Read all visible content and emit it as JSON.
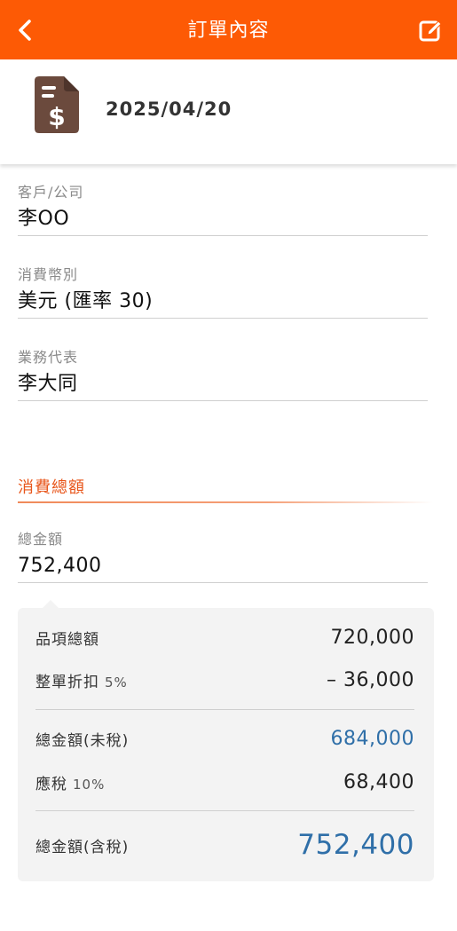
{
  "header": {
    "title": "訂單內容",
    "back_icon": "chevron-left-icon",
    "edit_icon": "edit-icon",
    "bar_color": "#fd5a05"
  },
  "order": {
    "date": "2025/04/20",
    "icon": "invoice-dollar-icon"
  },
  "fields": {
    "customer": {
      "label": "客戶/公司",
      "value": "李OO"
    },
    "currency": {
      "label": "消費幣別",
      "value": "美元 (匯率 30)"
    },
    "sales_rep": {
      "label": "業務代表",
      "value": "李大同"
    }
  },
  "total_section": {
    "title": "消費總額",
    "total_label": "總金額",
    "total_value": "752,400"
  },
  "breakdown": {
    "items_total": {
      "label": "品項總額",
      "value": "720,000"
    },
    "discount": {
      "label": "整單折扣",
      "pct": "5%",
      "value": "– 36,000"
    },
    "subtotal_pre_tax": {
      "label": "總金額(未稅)",
      "value": "684,000"
    },
    "tax": {
      "label": "應稅",
      "pct": "10%",
      "value": "68,400"
    },
    "grand_total": {
      "label": "總金額(含稅)",
      "value": "752,400"
    },
    "accent_color": "#2f6fa8"
  }
}
